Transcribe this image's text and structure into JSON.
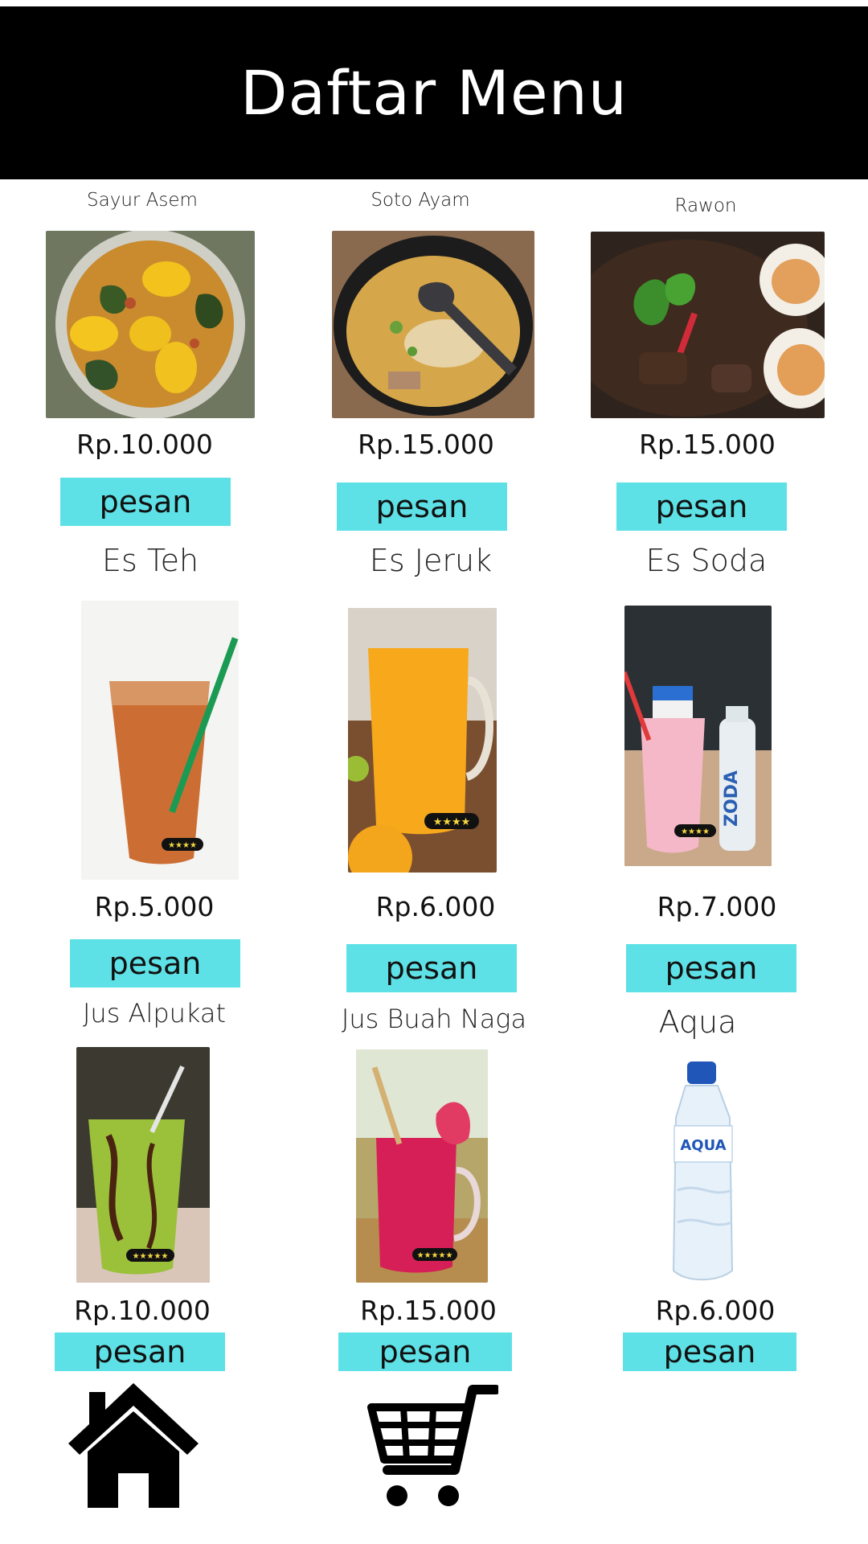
{
  "header": {
    "title": "Daftar Menu"
  },
  "menu": [
    {
      "name": "Sayur Asem",
      "price": "Rp.10.000",
      "button": "pesan"
    },
    {
      "name": "Soto Ayam",
      "price": "Rp.15.000",
      "button": "pesan"
    },
    {
      "name": "Rawon",
      "price": "Rp.15.000",
      "button": "pesan"
    },
    {
      "name": "Es Teh",
      "price": "Rp.5.000",
      "button": "pesan"
    },
    {
      "name": "Es Jeruk",
      "price": "Rp.6.000",
      "button": "pesan"
    },
    {
      "name": "Es Soda",
      "price": "Rp.7.000",
      "button": "pesan"
    },
    {
      "name": "Jus Alpukat",
      "price": "Rp.10.000",
      "button": "pesan"
    },
    {
      "name": "Jus Buah Naga",
      "price": "Rp.15.000",
      "button": "pesan"
    },
    {
      "name": "Aqua",
      "price": "Rp.6.000",
      "button": "pesan"
    }
  ],
  "photo_labels": {
    "zoda": "ZODA",
    "aqua": "AQUA"
  },
  "nav": {
    "icons": [
      "home-icon",
      "cart-icon"
    ]
  },
  "colors": {
    "header_bg": "#000000",
    "header_text": "#ffffff",
    "button_bg": "#5ee1e6"
  }
}
